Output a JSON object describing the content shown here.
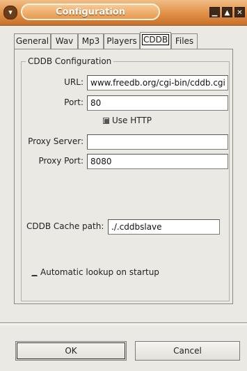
{
  "window": {
    "title": "Configuration",
    "menu_icon": "chevron-down-icon",
    "minimize_icon": "minimize-icon",
    "maximize_icon": "maximize-icon",
    "close_icon": "close-icon",
    "accent_color": "#e08f45"
  },
  "tabs": [
    {
      "label": "General",
      "active": false
    },
    {
      "label": "Wav",
      "active": false
    },
    {
      "label": "Mp3",
      "active": false
    },
    {
      "label": "Players",
      "active": false
    },
    {
      "label": "CDDB",
      "active": true
    },
    {
      "label": "Files",
      "active": false
    }
  ],
  "cddb": {
    "group_title": "CDDB Configuration",
    "url_label": "URL:",
    "url_value": "www.freedb.org/cgi-bin/cddb.cgi",
    "port_label": "Port:",
    "port_value": "80",
    "use_http_label": "Use HTTP",
    "use_http_checked": true,
    "proxy_server_label": "Proxy Server:",
    "proxy_server_value": "",
    "proxy_port_label": "Proxy Port:",
    "proxy_port_value": "8080",
    "cache_path_label": "CDDB Cache path:",
    "cache_path_value": "./.cddbslave",
    "auto_lookup_label": "Automatic lookup on startup",
    "auto_lookup_checked": false
  },
  "buttons": {
    "ok_label": "OK",
    "cancel_label": "Cancel"
  }
}
